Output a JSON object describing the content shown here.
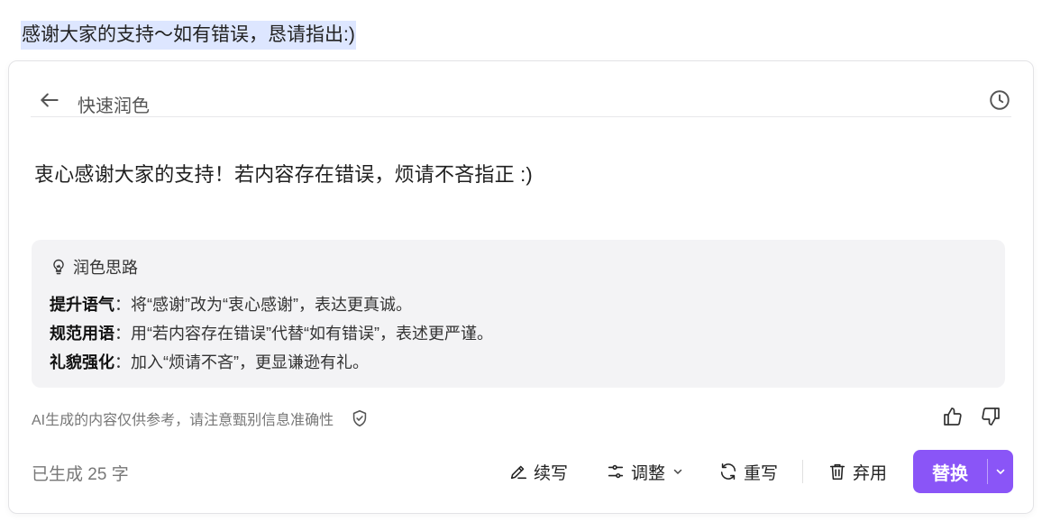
{
  "selection": {
    "text": "感谢大家的支持～如有错误，恳请指出:)"
  },
  "header": {
    "title": "快速润色",
    "back_icon": "arrow-left-icon",
    "history_icon": "clock-icon"
  },
  "result": {
    "text": "衷心感谢大家的支持！若内容存在错误，烦请不吝指正 :)"
  },
  "ideas": {
    "title": "润色思路",
    "icon": "lightbulb-icon",
    "items": [
      {
        "label": "提升语气",
        "desc": "：将“感谢”改为“衷心感谢”，表达更真诚。"
      },
      {
        "label": "规范用语",
        "desc": "：用“若内容存在错误”代替“如有错误”，表述更严谨。"
      },
      {
        "label": "礼貌强化",
        "desc": "：加入“烦请不吝”，更显谦逊有礼。"
      }
    ]
  },
  "footer": {
    "disclaimer": "AI生成的内容仅供参考，请注意甄别信息准确性",
    "word_count": "已生成 25 字"
  },
  "toolbar": {
    "continue_label": "续写",
    "adjust_label": "调整",
    "rewrite_label": "重写",
    "discard_label": "弃用",
    "replace_label": "替换"
  },
  "colors": {
    "accent": "#8a55f7",
    "selection_bg": "#dde6ff",
    "ideas_bg": "#f3f3f5"
  }
}
